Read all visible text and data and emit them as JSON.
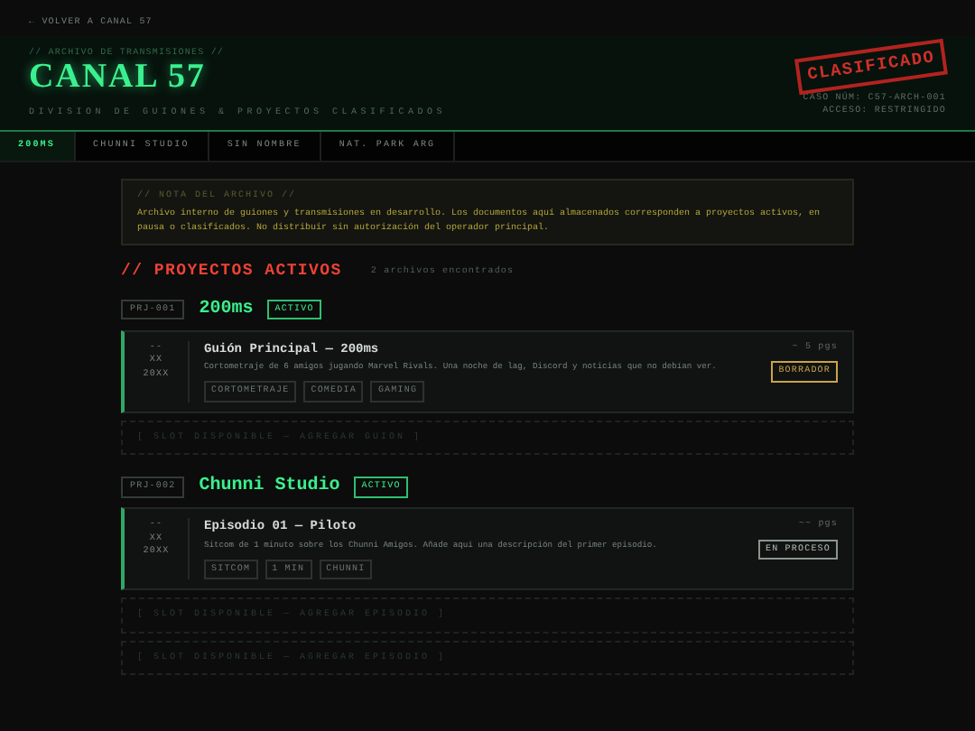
{
  "back_link": "← VOLVER A CANAL 57",
  "header": {
    "kicker": "// ARCHIVO DE TRANSMISIONES //",
    "title": "CANAL 57",
    "subtitle": "DIVISION DE GUIONES & PROYECTOS CLASIFICADOS",
    "stamp": "CLASIFICADO",
    "case_lines": [
      "CASO NÚM: C57-ARCH-001",
      "ACCESO: RESTRINGIDO"
    ]
  },
  "tabs": [
    {
      "label": "200MS",
      "selected": true
    },
    {
      "label": "CHUNNI STUDIO",
      "selected": false
    },
    {
      "label": "SIN NOMBRE",
      "selected": false
    },
    {
      "label": "NAT. PARK ARG",
      "selected": false
    }
  ],
  "note": {
    "title": "// NOTA DEL ARCHIVO //",
    "text": "Archivo interno de guiones y transmisiones en desarrollo. Los documentos aquí almacenados corresponden a proyectos activos, en pausa o clasificados. No distribuir sin autorización del operador principal."
  },
  "section": {
    "title": "// PROYECTOS ACTIVOS",
    "count": "2 archivos encontrados"
  },
  "projects": [
    {
      "code": "PRJ-001",
      "name": "200ms",
      "status": "ACTIVO",
      "items": [
        {
          "kind": "script",
          "date": [
            "--",
            "XX",
            "20XX"
          ],
          "title": "Guión Principal — 200ms",
          "description": "Cortometraje de 6 amigos jugando Marvel Rivals. Una noche de lag, Discord y noticias que no debían ver.",
          "tags": [
            "CORTOMETRAJE",
            "COMEDIA",
            "GAMING"
          ],
          "pages": "~ 5 pgs",
          "badge": {
            "label": "BORRADOR",
            "kind": "draft"
          }
        },
        {
          "kind": "slot",
          "text": "[ SLOT DISPONIBLE — AGREGAR GUION ]"
        }
      ]
    },
    {
      "code": "PRJ-002",
      "name": "Chunni Studio",
      "status": "ACTIVO",
      "items": [
        {
          "kind": "script",
          "date": [
            "--",
            "XX",
            "20XX"
          ],
          "title": "Episodio 01 — Piloto",
          "description": "Sitcom de 1 minuto sobre los Chunni Amigos. Añade aquí una descripción del primer episodio.",
          "tags": [
            "SITCOM",
            "1 MIN",
            "CHUNNI"
          ],
          "pages": "~~ pgs",
          "badge": {
            "label": "EN PROCESO",
            "kind": "progress"
          }
        },
        {
          "kind": "slot",
          "text": "[ SLOT DISPONIBLE — AGREGAR EPISODIO ]"
        },
        {
          "kind": "slot",
          "text": "[ SLOT DISPONIBLE — AGREGAR EPISODIO ]"
        }
      ]
    }
  ]
}
